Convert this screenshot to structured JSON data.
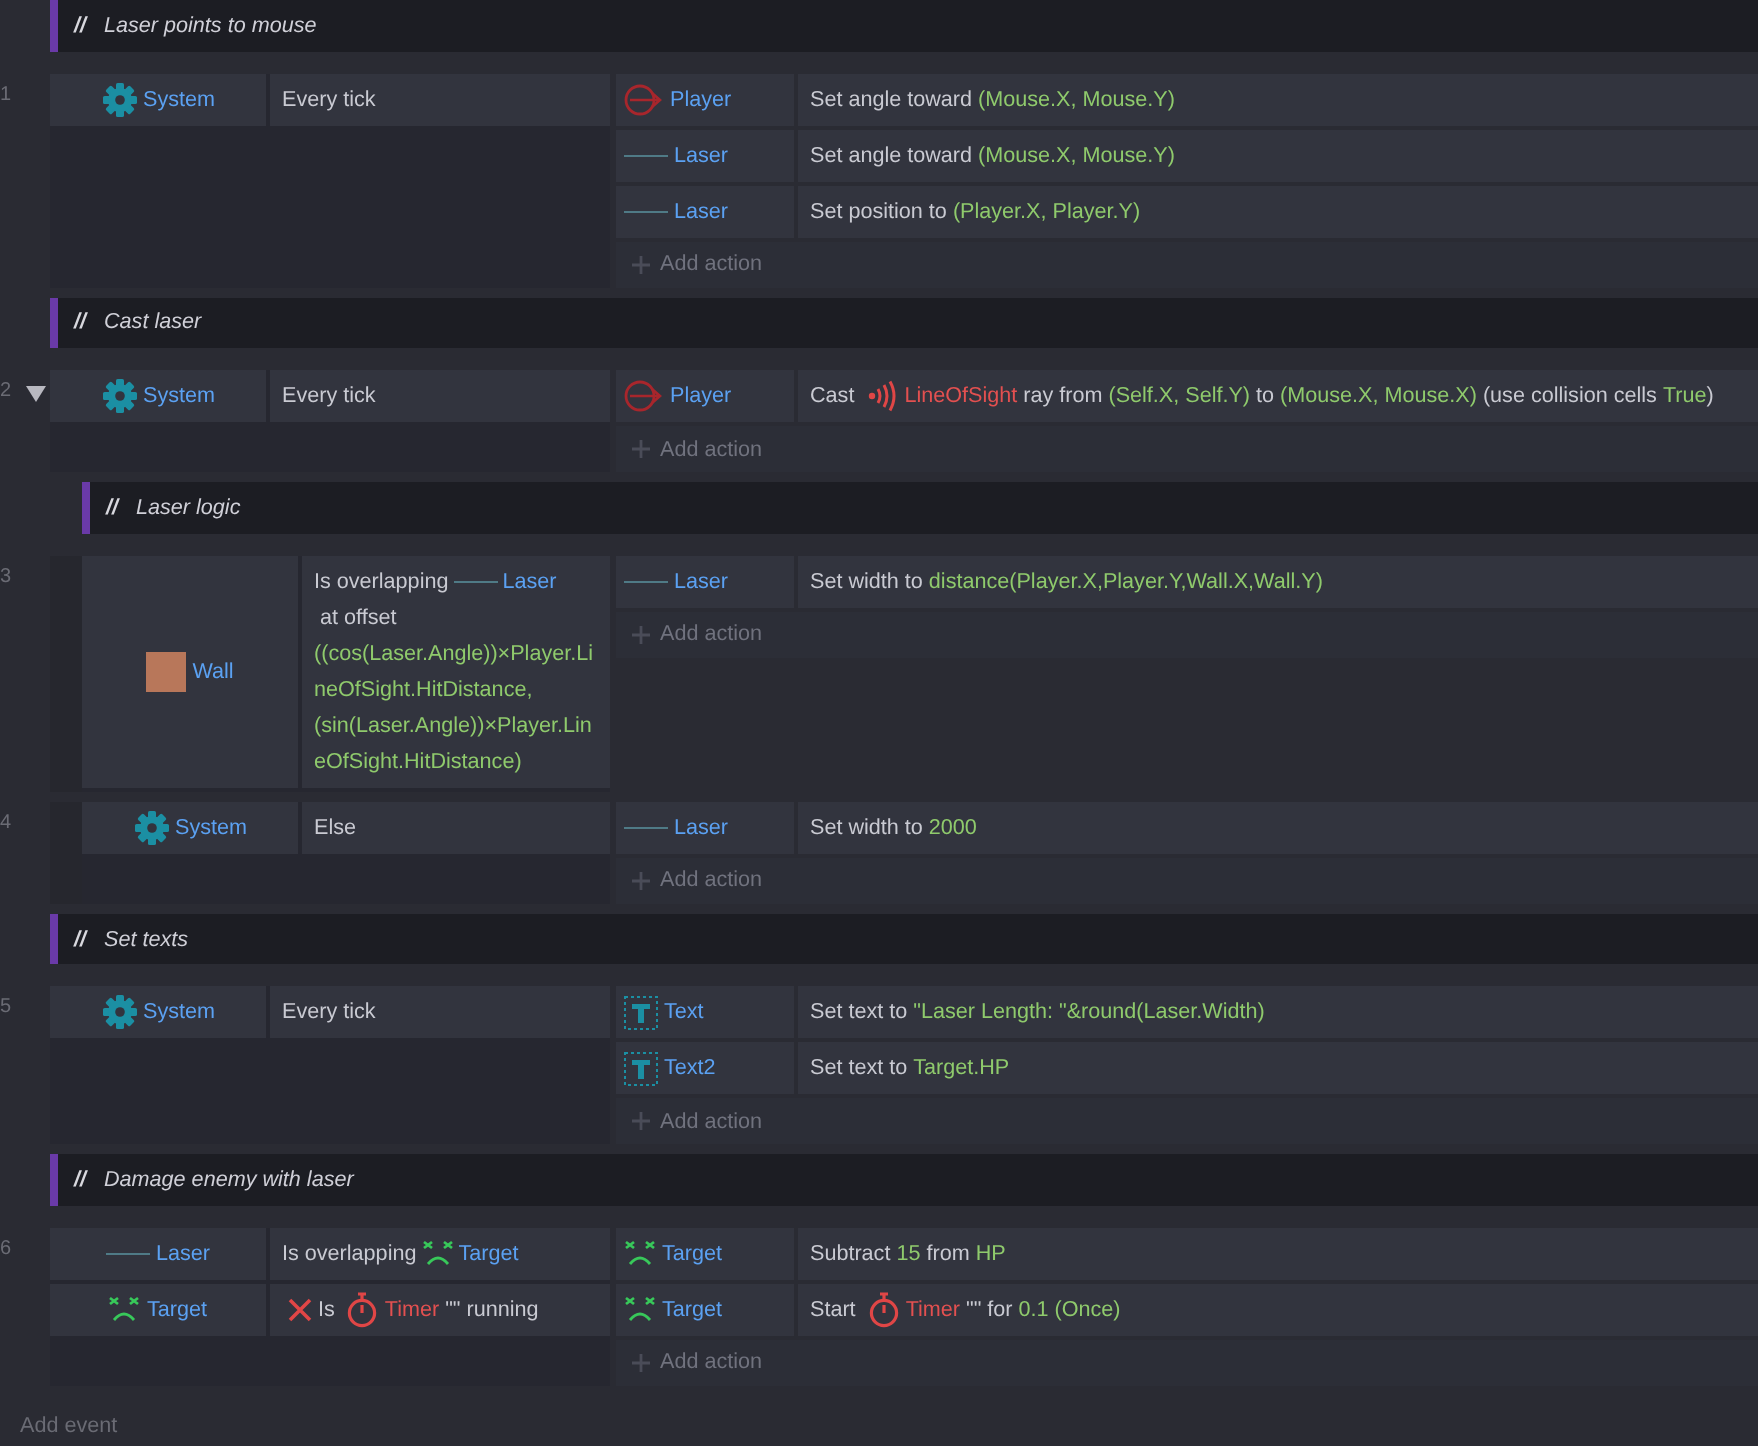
{
  "sheet": [
    {
      "kind": "comment",
      "marker": "//",
      "text": "Laser points to mouse"
    },
    {
      "kind": "event",
      "number": "1",
      "conditions": [
        {
          "object": {
            "kind": "system",
            "name": "System"
          },
          "inverted": false,
          "parts": [
            {
              "kind": "plain",
              "text": "Every tick"
            }
          ]
        }
      ],
      "actions": [
        {
          "object": {
            "kind": "player",
            "name": "Player"
          },
          "parts": [
            {
              "kind": "plain",
              "text": "Set angle toward "
            },
            {
              "kind": "param",
              "text": "(Mouse.X, Mouse.Y)"
            }
          ]
        },
        {
          "object": {
            "kind": "line",
            "name": "Laser"
          },
          "parts": [
            {
              "kind": "plain",
              "text": "Set angle toward "
            },
            {
              "kind": "param",
              "text": "(Mouse.X, Mouse.Y)"
            }
          ]
        },
        {
          "object": {
            "kind": "line",
            "name": "Laser"
          },
          "parts": [
            {
              "kind": "plain",
              "text": "Set position to "
            },
            {
              "kind": "param",
              "text": "(Player.X, Player.Y)"
            }
          ]
        }
      ],
      "add_action": "Add action"
    },
    {
      "kind": "comment",
      "marker": "//",
      "text": "Cast laser"
    },
    {
      "kind": "event",
      "number": "2",
      "expanded": true,
      "conditions": [
        {
          "object": {
            "kind": "system",
            "name": "System"
          },
          "inverted": false,
          "parts": [
            {
              "kind": "plain",
              "text": "Every tick"
            }
          ]
        }
      ],
      "actions": [
        {
          "object": {
            "kind": "player",
            "name": "Player"
          },
          "parts": [
            {
              "kind": "plain",
              "text": "Cast "
            },
            {
              "kind": "ray",
              "text": "LineOfSight"
            },
            {
              "kind": "plain",
              "text": " ray from "
            },
            {
              "kind": "param",
              "text": "(Self.X, Self.Y)"
            },
            {
              "kind": "plain",
              "text": " to "
            },
            {
              "kind": "param",
              "text": "(Mouse.X, Mouse.X)"
            },
            {
              "kind": "plain",
              "text": " (use collision cells "
            },
            {
              "kind": "param",
              "text": "True"
            },
            {
              "kind": "plain",
              "text": ")"
            }
          ]
        }
      ],
      "add_action": "Add action",
      "children": [
        {
          "kind": "comment",
          "marker": "//",
          "text": "Laser logic"
        },
        {
          "kind": "event",
          "number": "3",
          "conditions": [
            {
              "object": {
                "kind": "wall",
                "name": "Wall"
              },
              "inverted": false,
              "parts": [
                {
                  "kind": "plain",
                  "text": "Is overlapping "
                },
                {
                  "kind": "line-object",
                  "text": "Laser"
                },
                {
                  "kind": "plain",
                  "text": " at offset "
                },
                {
                  "kind": "param",
                  "text": "((cos(Laser.Angle))×Player.LineOfSight.HitDistance, (sin(Laser.Angle))×Player.LineOfSight.HitDistance)"
                }
              ]
            }
          ],
          "actions": [
            {
              "object": {
                "kind": "line",
                "name": "Laser"
              },
              "parts": [
                {
                  "kind": "plain",
                  "text": "Set width to "
                },
                {
                  "kind": "param",
                  "text": "distance(Player.X,Player.Y,Wall.X,Wall.Y)"
                }
              ]
            }
          ],
          "add_action": "Add action"
        },
        {
          "kind": "event",
          "number": "4",
          "conditions": [
            {
              "object": {
                "kind": "system",
                "name": "System"
              },
              "inverted": false,
              "parts": [
                {
                  "kind": "plain",
                  "text": "Else"
                }
              ]
            }
          ],
          "actions": [
            {
              "object": {
                "kind": "line",
                "name": "Laser"
              },
              "parts": [
                {
                  "kind": "plain",
                  "text": "Set width to "
                },
                {
                  "kind": "param",
                  "text": "2000"
                }
              ]
            }
          ],
          "add_action": "Add action"
        }
      ]
    },
    {
      "kind": "comment",
      "marker": "//",
      "text": "Set texts"
    },
    {
      "kind": "event",
      "number": "5",
      "conditions": [
        {
          "object": {
            "kind": "system",
            "name": "System"
          },
          "inverted": false,
          "parts": [
            {
              "kind": "plain",
              "text": "Every tick"
            }
          ]
        }
      ],
      "actions": [
        {
          "object": {
            "kind": "text",
            "name": "Text"
          },
          "parts": [
            {
              "kind": "plain",
              "text": "Set text to "
            },
            {
              "kind": "param",
              "text": "\"Laser Length: \"&round(Laser.Width)"
            }
          ]
        },
        {
          "object": {
            "kind": "text",
            "name": "Text2"
          },
          "parts": [
            {
              "kind": "plain",
              "text": "Set text to "
            },
            {
              "kind": "param",
              "text": "Target.HP"
            }
          ]
        }
      ],
      "add_action": "Add action"
    },
    {
      "kind": "comment",
      "marker": "//",
      "text": "Damage enemy with laser"
    },
    {
      "kind": "event",
      "number": "6",
      "conditions": [
        {
          "object": {
            "kind": "line",
            "name": "Laser"
          },
          "inverted": false,
          "parts": [
            {
              "kind": "plain",
              "text": "Is overlapping "
            },
            {
              "kind": "enemy-object",
              "text": "Target"
            }
          ]
        },
        {
          "object": {
            "kind": "enemy",
            "name": "Target"
          },
          "inverted": true,
          "parts": [
            {
              "kind": "plain",
              "text": "Is "
            },
            {
              "kind": "timer",
              "text": "Timer"
            },
            {
              "kind": "plain",
              "text": " \"\" running"
            }
          ]
        }
      ],
      "actions": [
        {
          "object": {
            "kind": "enemy",
            "name": "Target"
          },
          "parts": [
            {
              "kind": "plain",
              "text": "Subtract "
            },
            {
              "kind": "param",
              "text": "15"
            },
            {
              "kind": "plain",
              "text": " from "
            },
            {
              "kind": "param",
              "text": "HP"
            }
          ]
        },
        {
          "object": {
            "kind": "enemy",
            "name": "Target"
          },
          "parts": [
            {
              "kind": "plain",
              "text": "Start "
            },
            {
              "kind": "timer",
              "text": "Timer"
            },
            {
              "kind": "plain",
              "text": " \"\" for "
            },
            {
              "kind": "param",
              "text": "0.1 (Once)"
            }
          ]
        }
      ],
      "add_action": "Add action"
    }
  ],
  "add_event": "Add event"
}
